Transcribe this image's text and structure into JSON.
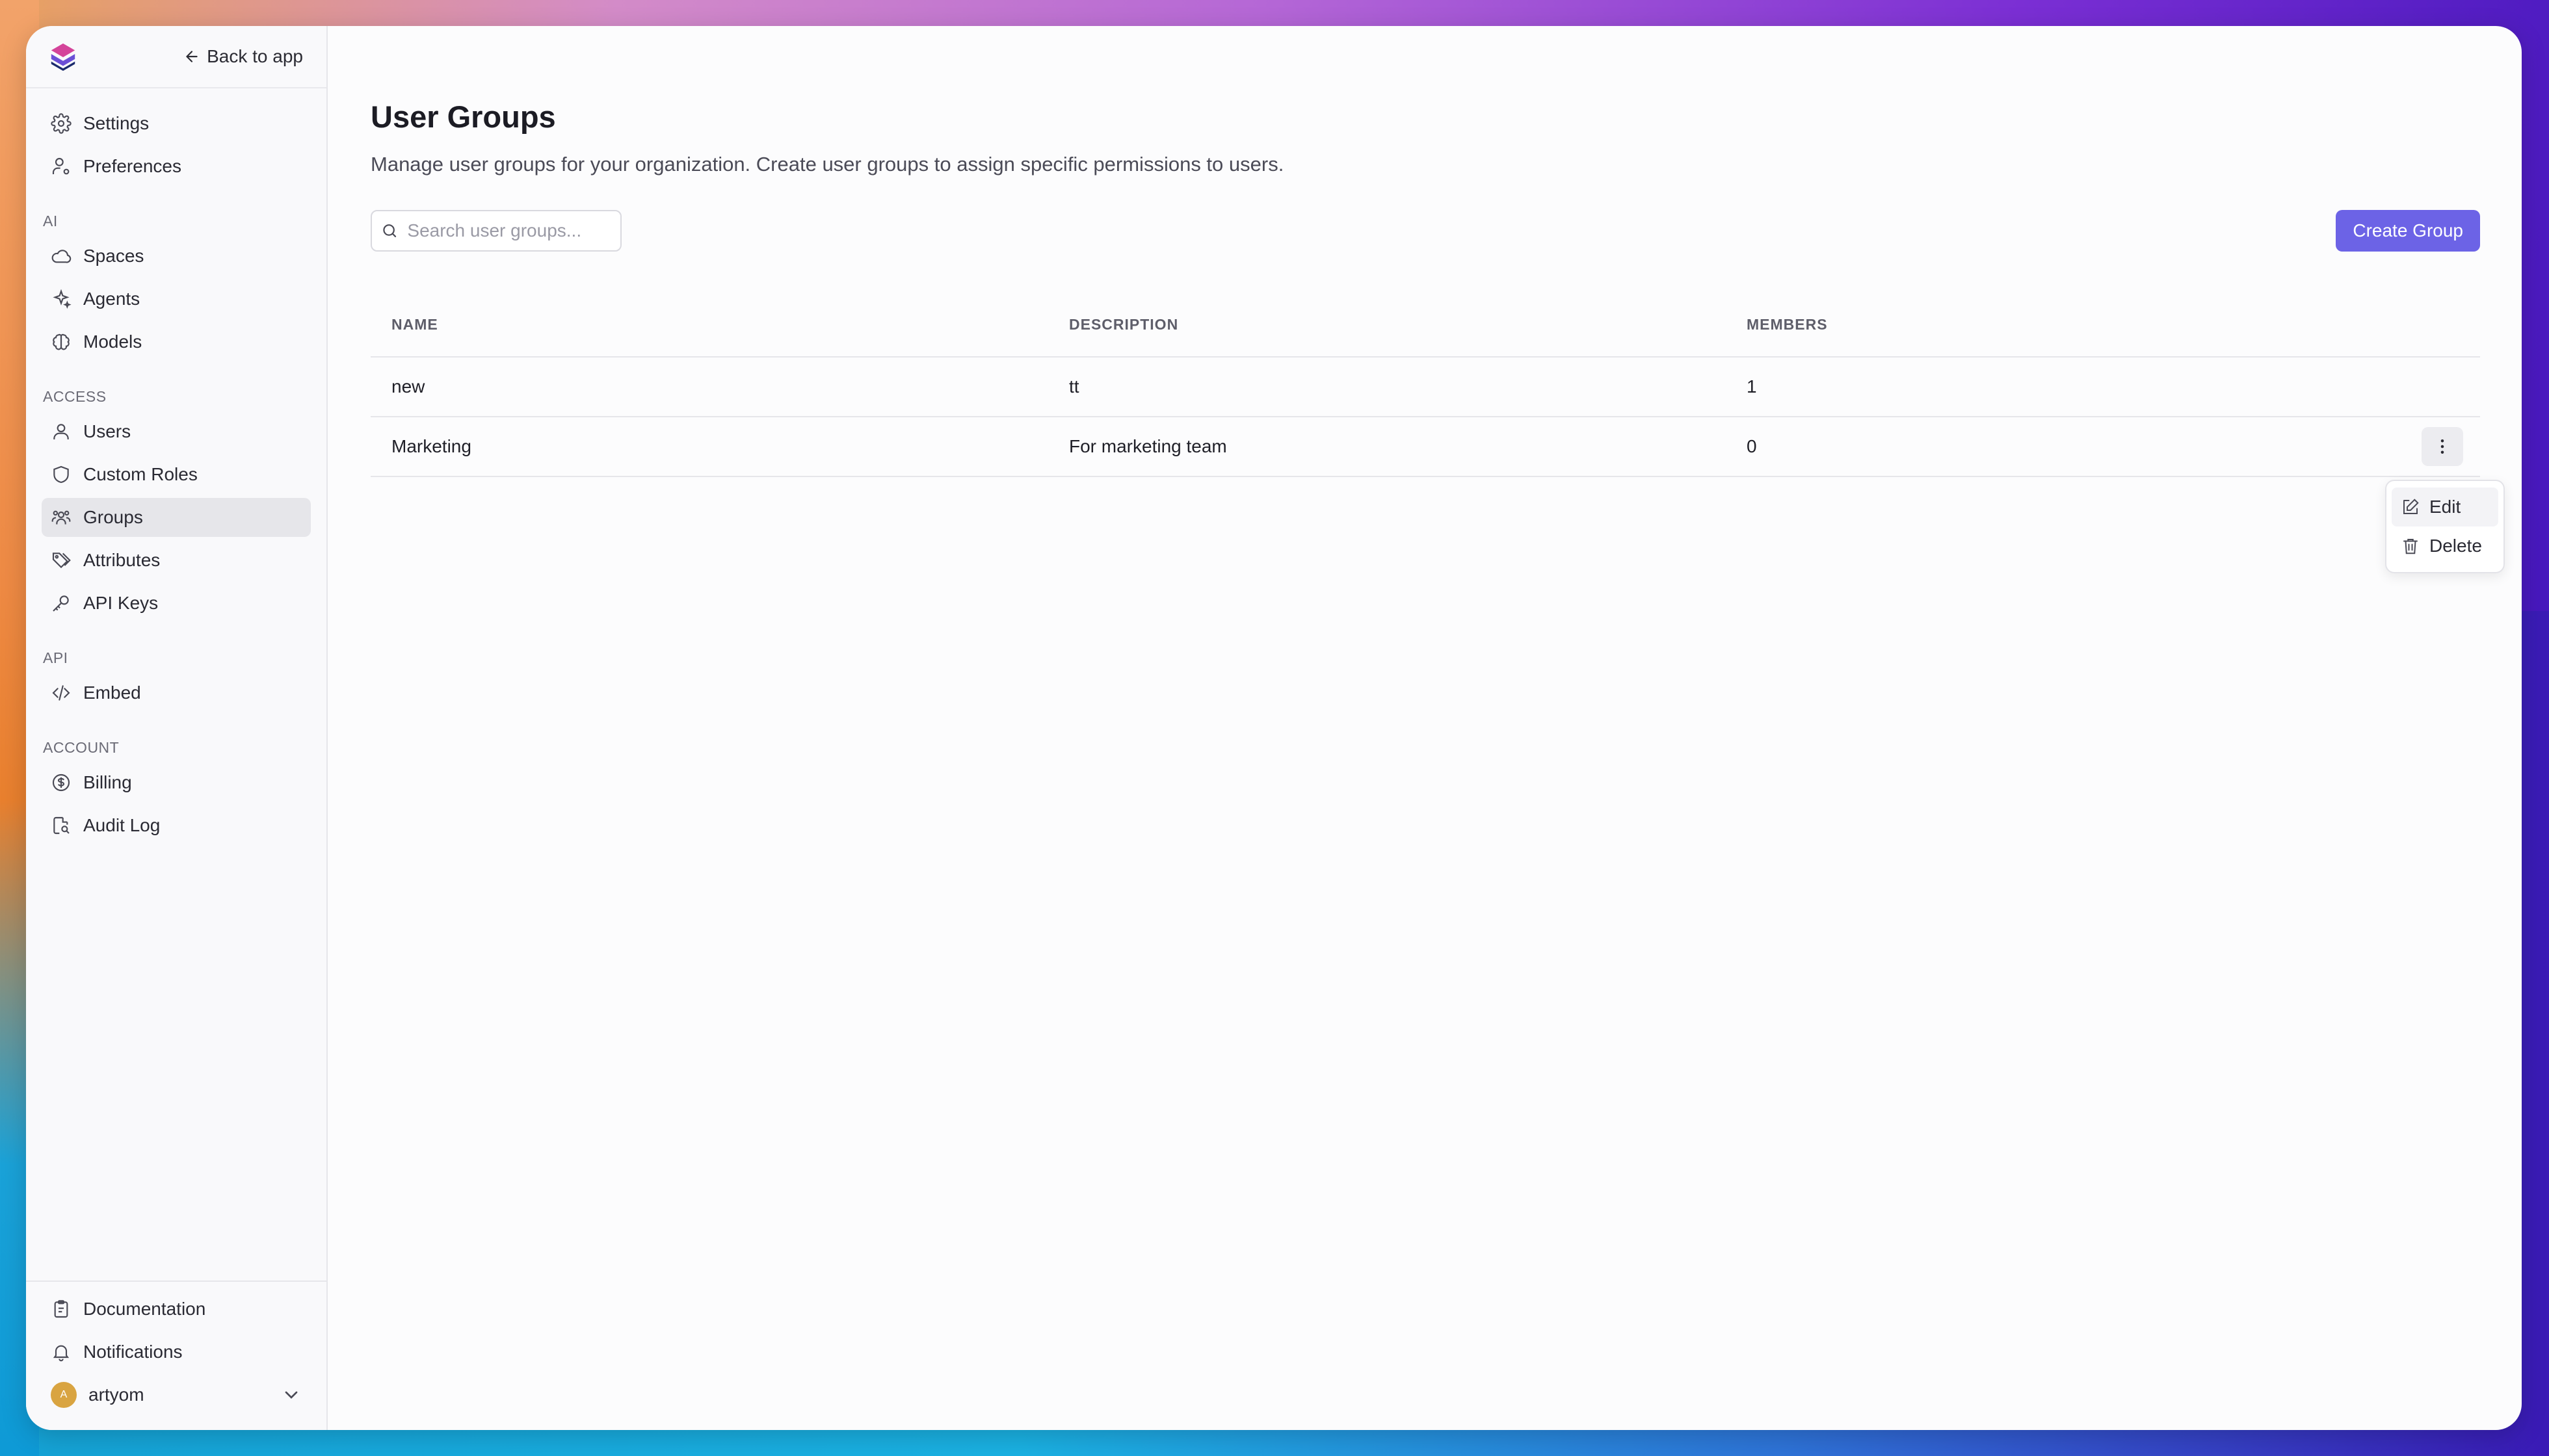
{
  "sidebar": {
    "back_label": "Back to app",
    "top_items": [
      {
        "label": "Settings",
        "icon": "gear-icon"
      },
      {
        "label": "Preferences",
        "icon": "user-cog-icon"
      }
    ],
    "sections": [
      {
        "label": "AI",
        "items": [
          {
            "label": "Spaces",
            "icon": "cloud-icon"
          },
          {
            "label": "Agents",
            "icon": "sparkles-icon"
          },
          {
            "label": "Models",
            "icon": "brain-icon"
          }
        ]
      },
      {
        "label": "ACCESS",
        "items": [
          {
            "label": "Users",
            "icon": "user-icon"
          },
          {
            "label": "Custom Roles",
            "icon": "shield-icon"
          },
          {
            "label": "Groups",
            "icon": "users-icon",
            "active": true
          },
          {
            "label": "Attributes",
            "icon": "tags-icon"
          },
          {
            "label": "API Keys",
            "icon": "key-icon"
          }
        ]
      },
      {
        "label": "API",
        "items": [
          {
            "label": "Embed",
            "icon": "code-icon"
          }
        ]
      },
      {
        "label": "ACCOUNT",
        "items": [
          {
            "label": "Billing",
            "icon": "dollar-icon"
          },
          {
            "label": "Audit Log",
            "icon": "file-search-icon"
          }
        ]
      }
    ],
    "bottom": {
      "documentation": "Documentation",
      "notifications": "Notifications",
      "user_name": "artyom",
      "user_initial": "A"
    }
  },
  "main": {
    "title": "User Groups",
    "subtitle": "Manage user groups for your organization. Create user groups to assign specific permissions to users.",
    "search_placeholder": "Search user groups...",
    "create_button": "Create Group",
    "table": {
      "columns": [
        "NAME",
        "DESCRIPTION",
        "MEMBERS"
      ],
      "rows": [
        {
          "name": "new",
          "description": "tt",
          "members": "1"
        },
        {
          "name": "Marketing",
          "description": "For marketing team",
          "members": "0"
        }
      ]
    },
    "row_menu": {
      "edit": "Edit",
      "delete": "Delete"
    }
  },
  "colors": {
    "accent": "#6c63e6",
    "active_nav": "#e6e6ea",
    "avatar": "#d9a441"
  }
}
